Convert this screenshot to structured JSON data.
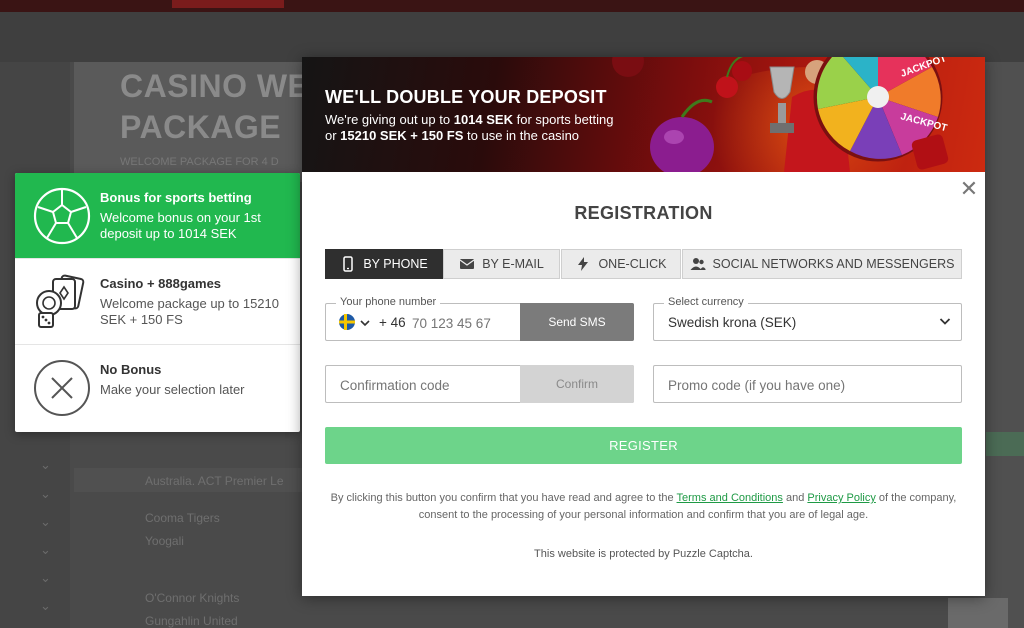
{
  "background": {
    "banner_title_line1": "CASINO WE",
    "banner_title_line2": "PACKAGE",
    "banner_subtitle": "WELCOME PACKAGE FOR 4 D",
    "rows": [
      "Australia. ACT Premier Le",
      "Cooma Tigers",
      "Yoogali",
      "O'Connor Knights",
      "Gungahlin United"
    ]
  },
  "bonus_panel": {
    "options": [
      {
        "title": "Bonus for sports betting",
        "description": "Welcome bonus on your 1st deposit up to 1014 SEK",
        "selected": true,
        "icon": "soccer-ball-icon"
      },
      {
        "title": "Casino + 888games",
        "description": "Welcome package up to 15210 SEK + 150 FS",
        "selected": false,
        "icon": "casino-chips-cards-icon"
      },
      {
        "title": "No Bonus",
        "description": "Make your selection later",
        "selected": false,
        "icon": "no-bonus-x-icon"
      }
    ]
  },
  "promo": {
    "title": "WE'LL DOUBLE YOUR DEPOSIT",
    "line1_prefix": "We're giving out up to ",
    "line1_bold": "1014 SEK",
    "line1_suffix": " for sports betting",
    "line2_prefix": "or ",
    "line2_bold": "15210 SEK + 150 FS",
    "line2_suffix": " to use in the casino",
    "wheel_label": "JACKPOT"
  },
  "registration": {
    "title": "REGISTRATION",
    "close_symbol": "✕",
    "tabs": [
      {
        "label": "BY PHONE",
        "icon": "phone-icon",
        "active": true
      },
      {
        "label": "BY E-MAIL",
        "icon": "envelope-icon",
        "active": false
      },
      {
        "label": "ONE-CLICK",
        "icon": "lightning-icon",
        "active": false
      },
      {
        "label": "SOCIAL NETWORKS AND MESSENGERS",
        "icon": "people-icon",
        "active": false
      }
    ],
    "phone": {
      "label": "Your phone number",
      "country_code": "+ 46",
      "placeholder": "70 123 45 67",
      "send_sms_label": "Send SMS",
      "country_flag": "sweden-flag-icon"
    },
    "currency": {
      "label": "Select currency",
      "value": "Swedish krona (SEK)"
    },
    "confirmation": {
      "placeholder": "Confirmation code",
      "confirm_label": "Confirm"
    },
    "promo_code": {
      "placeholder": "Promo code (if you have one)"
    },
    "register_label": "REGISTER",
    "terms": {
      "prefix": "By clicking this button you confirm that you have read and agree to the ",
      "terms_link": "Terms and Conditions",
      "and": " and ",
      "privacy_link": "Privacy Policy",
      "suffix": " of the company, consent to the processing of your personal information and confirm that you are of legal age."
    },
    "captcha_note": "This website is protected by Puzzle Captcha."
  },
  "colors": {
    "accent_green": "#21b84f",
    "register_green": "#6dd48a",
    "link_green": "#1e9a45",
    "tab_active": "#2f2f2f"
  }
}
